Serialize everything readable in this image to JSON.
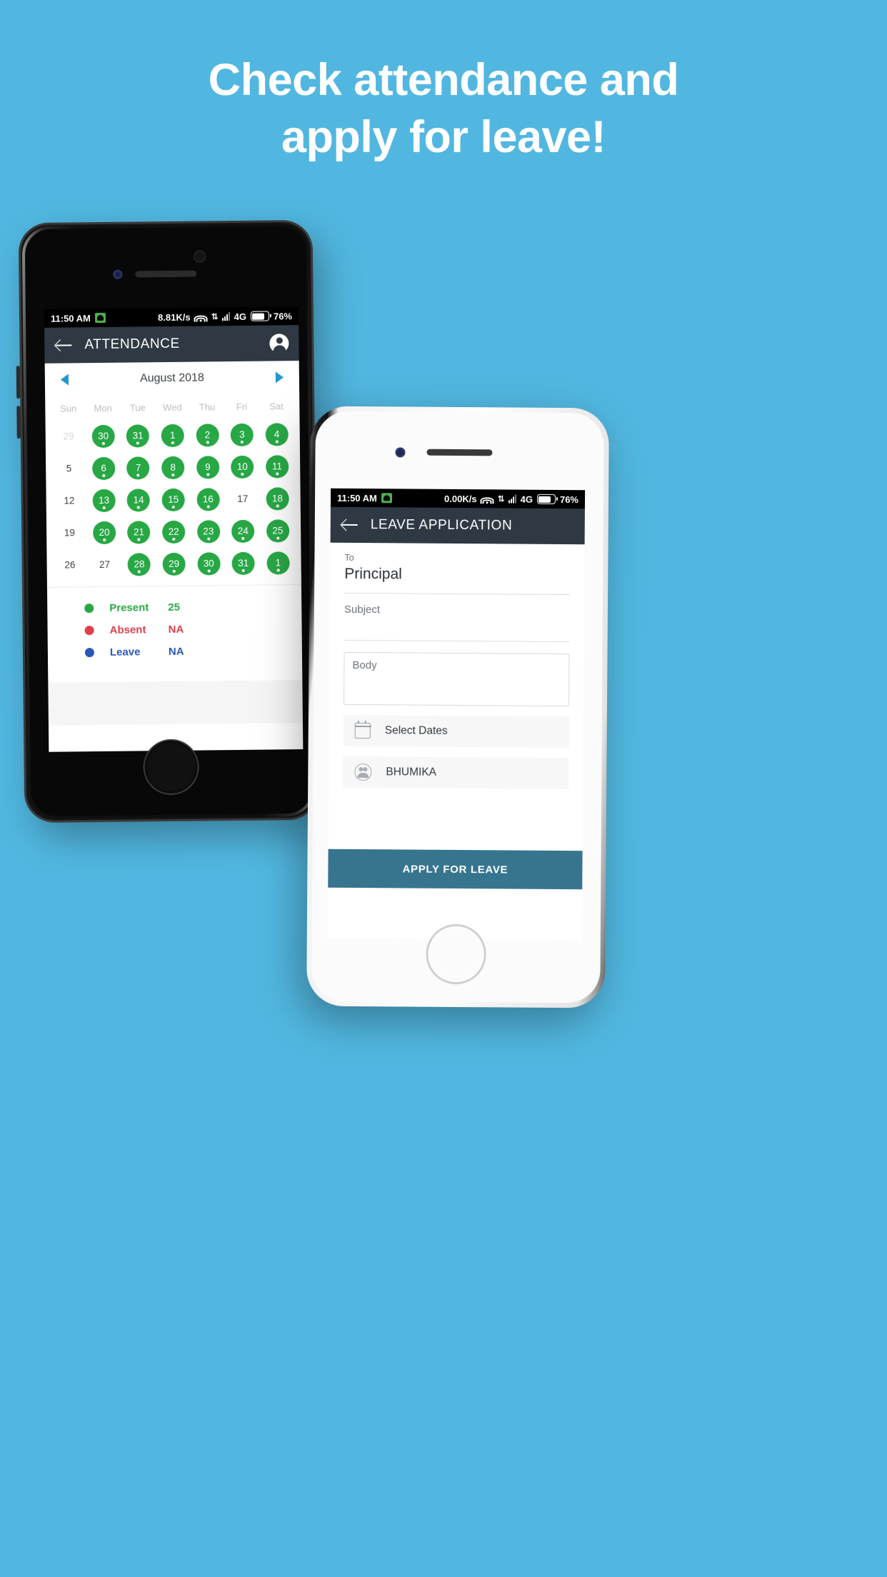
{
  "headline": {
    "line1": "Check attendance and",
    "line2": "apply for leave!"
  },
  "theme": {
    "background": "#51b7e0",
    "appbar": "#2e3943",
    "present_green": "#28a745",
    "absent_red": "#e03e4a",
    "leave_blue": "#2a57b5",
    "accent_blue": "#2196cf",
    "apply_button": "#37758f"
  },
  "phone_attendance": {
    "status_bar": {
      "time": "11:50 AM",
      "android_icon": "android-notification-icon",
      "network_speed": "8.81K/s",
      "wifi_icon": "wifi-icon",
      "data_transfer_icon": "data-transfer-icon",
      "signal_icon": "signal-bars-icon",
      "network_type": "4G",
      "battery_icon": "battery-icon",
      "battery_level": "76%"
    },
    "appbar": {
      "back_icon": "arrow-back-icon",
      "title": "ATTENDANCE",
      "account_icon": "account-circle-icon"
    },
    "calendar": {
      "prev_icon": "chevron-left-icon",
      "month_title": "August 2018",
      "next_icon": "chevron-right-icon",
      "weekdays": [
        "Sun",
        "Mon",
        "Tue",
        "Wed",
        "Thu",
        "Fri",
        "Sat"
      ],
      "weeks": [
        [
          {
            "day": "29",
            "state": "outside"
          },
          {
            "day": "30",
            "state": "present"
          },
          {
            "day": "31",
            "state": "present"
          },
          {
            "day": "1",
            "state": "present"
          },
          {
            "day": "2",
            "state": "present"
          },
          {
            "day": "3",
            "state": "present"
          },
          {
            "day": "4",
            "state": "present"
          }
        ],
        [
          {
            "day": "5",
            "state": "plain"
          },
          {
            "day": "6",
            "state": "present"
          },
          {
            "day": "7",
            "state": "present"
          },
          {
            "day": "8",
            "state": "present"
          },
          {
            "day": "9",
            "state": "present"
          },
          {
            "day": "10",
            "state": "present"
          },
          {
            "day": "11",
            "state": "present"
          }
        ],
        [
          {
            "day": "12",
            "state": "plain"
          },
          {
            "day": "13",
            "state": "present"
          },
          {
            "day": "14",
            "state": "present"
          },
          {
            "day": "15",
            "state": "present"
          },
          {
            "day": "16",
            "state": "present"
          },
          {
            "day": "17",
            "state": "plain"
          },
          {
            "day": "18",
            "state": "present"
          }
        ],
        [
          {
            "day": "19",
            "state": "plain"
          },
          {
            "day": "20",
            "state": "present"
          },
          {
            "day": "21",
            "state": "present"
          },
          {
            "day": "22",
            "state": "present"
          },
          {
            "day": "23",
            "state": "present"
          },
          {
            "day": "24",
            "state": "present"
          },
          {
            "day": "25",
            "state": "present"
          }
        ],
        [
          {
            "day": "26",
            "state": "plain"
          },
          {
            "day": "27",
            "state": "plain"
          },
          {
            "day": "28",
            "state": "present"
          },
          {
            "day": "29",
            "state": "present"
          },
          {
            "day": "30",
            "state": "present"
          },
          {
            "day": "31",
            "state": "present"
          },
          {
            "day": "1",
            "state": "present"
          }
        ]
      ]
    },
    "legend": [
      {
        "label": "Present",
        "value": "25",
        "color": "#28a745"
      },
      {
        "label": "Absent",
        "value": "NA",
        "color": "#e03e4a"
      },
      {
        "label": "Leave",
        "value": "NA",
        "color": "#2a57b5"
      }
    ]
  },
  "phone_leave": {
    "status_bar": {
      "time": "11:50 AM",
      "android_icon": "android-notification-icon",
      "network_speed": "0.00K/s",
      "wifi_icon": "wifi-icon",
      "data_transfer_icon": "data-transfer-icon",
      "signal_icon": "signal-bars-icon",
      "network_type": "4G",
      "battery_icon": "battery-icon",
      "battery_level": "76%"
    },
    "appbar": {
      "back_icon": "arrow-back-icon",
      "title": "LEAVE APPLICATION"
    },
    "form": {
      "to_label": "To",
      "to_value": "Principal",
      "subject_placeholder": "Subject",
      "subject_value": "",
      "body_placeholder": "Body",
      "body_value": "",
      "select_dates_label": "Select Dates",
      "select_dates_icon": "calendar-icon",
      "recipient_label": "BHUMIKA",
      "recipient_icon": "group-icon",
      "apply_button_label": "APPLY FOR LEAVE"
    }
  }
}
